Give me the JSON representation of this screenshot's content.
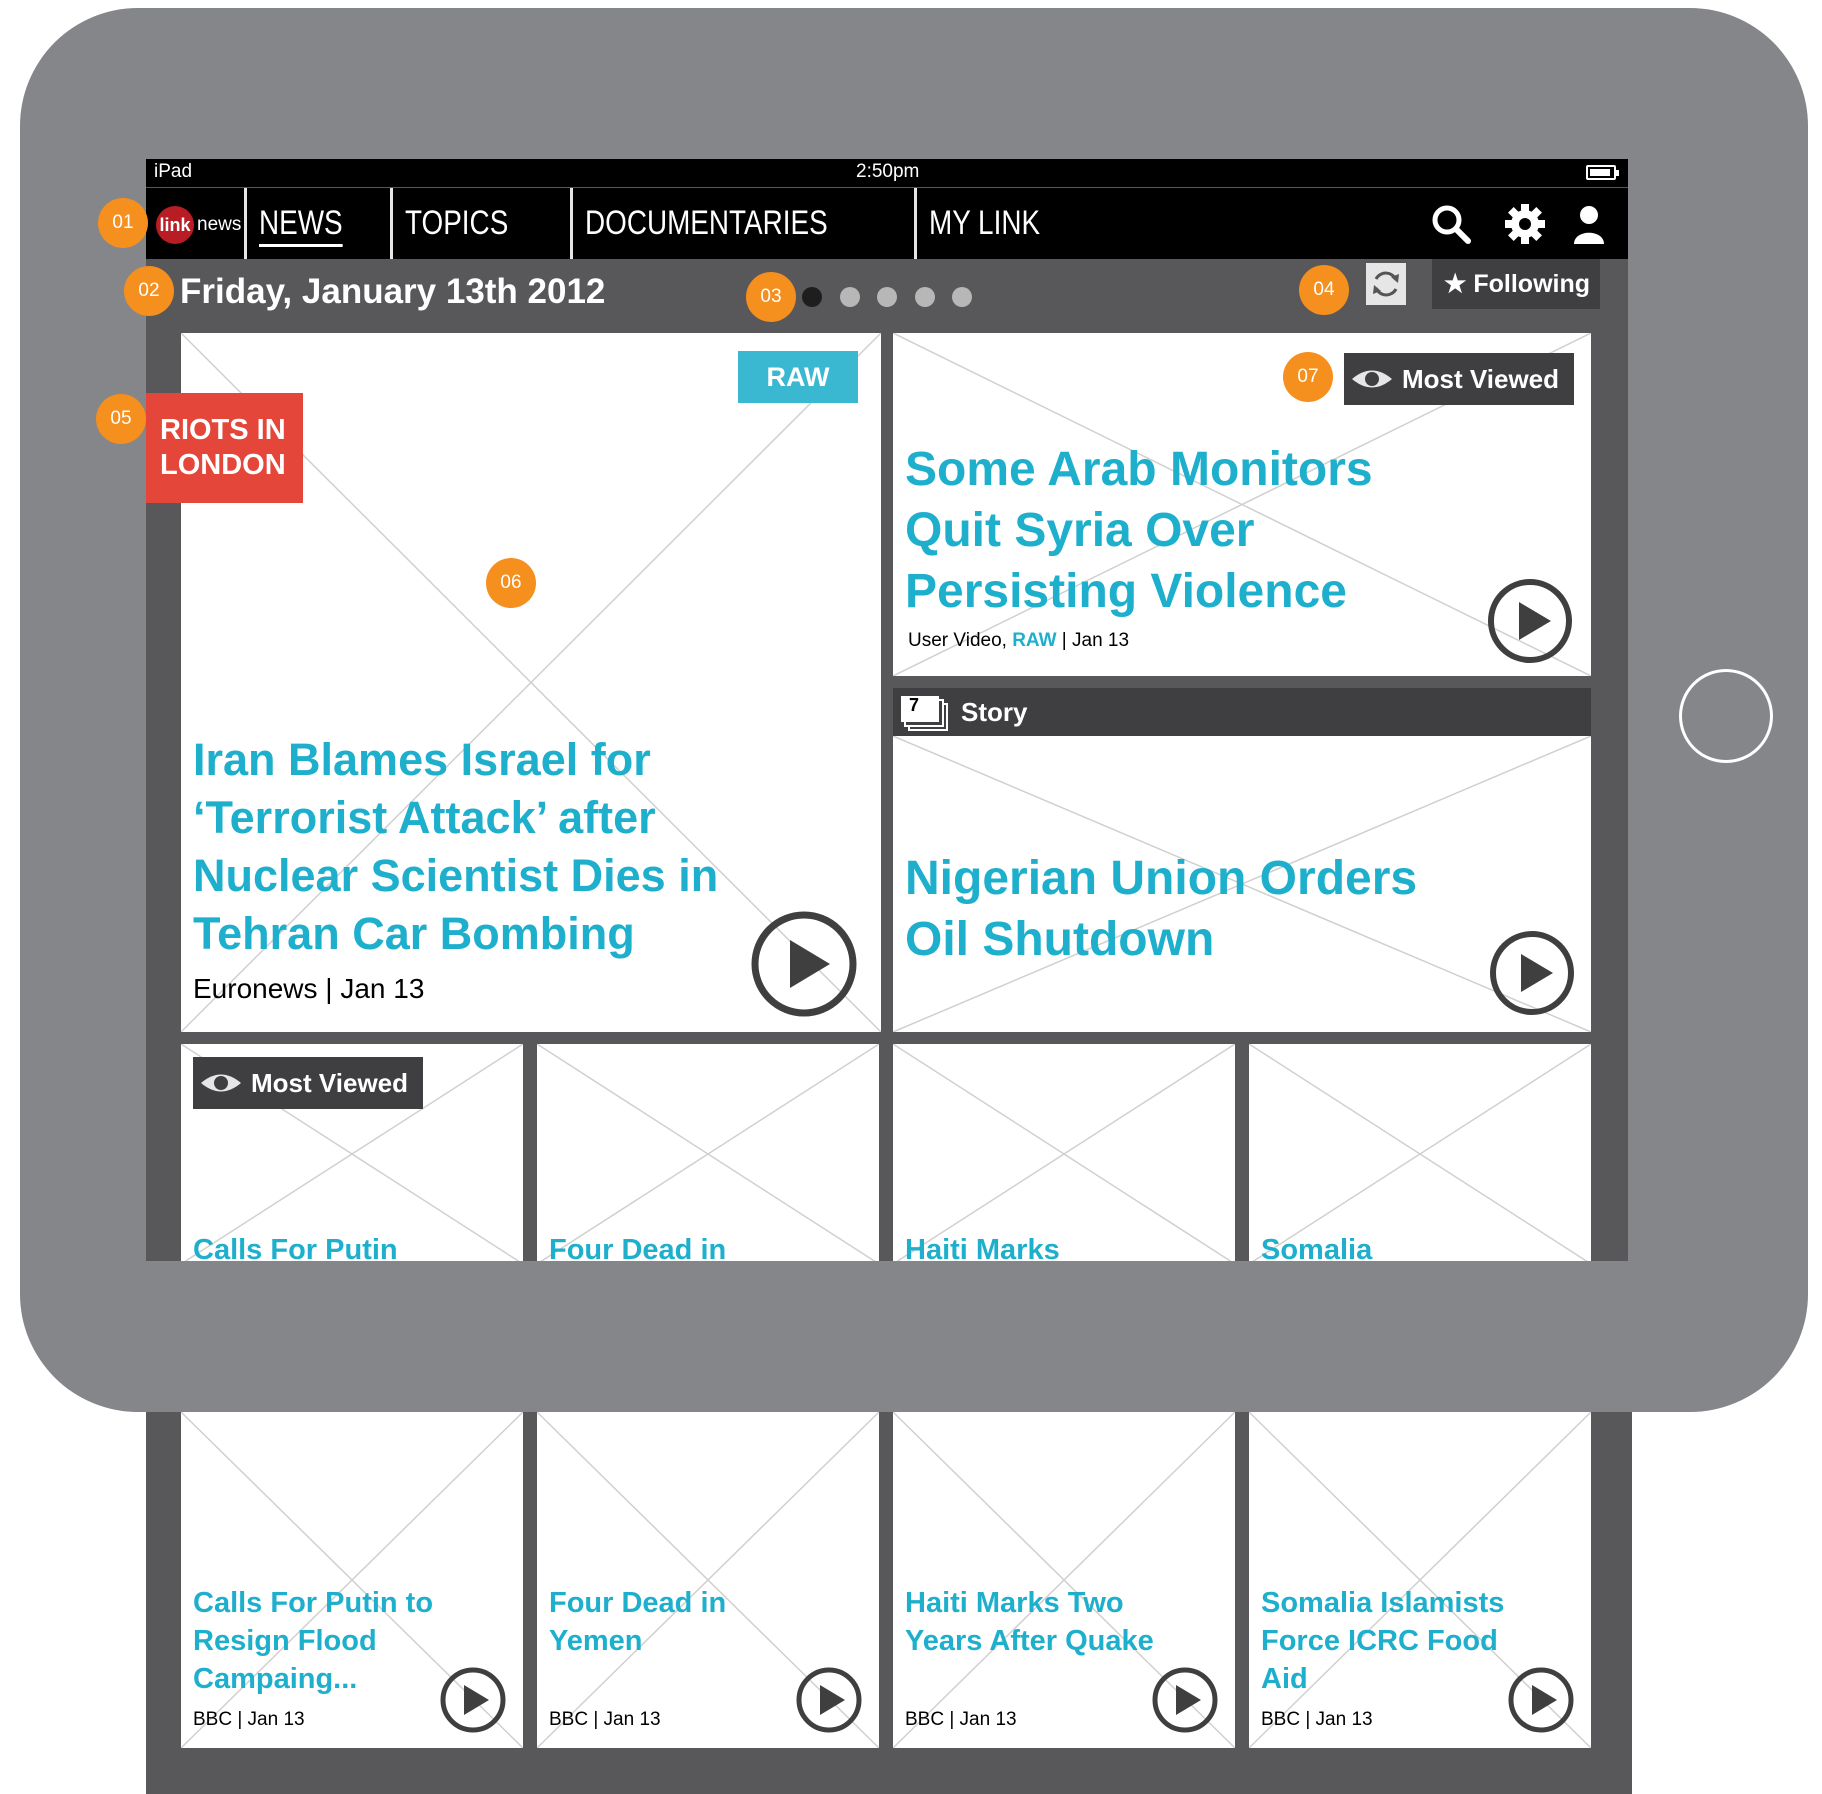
{
  "status_bar": {
    "device": "iPad",
    "time": "2:50pm"
  },
  "nav": {
    "logo_mark": "link",
    "logo_text": "news",
    "tabs": [
      "NEWS",
      "TOPICS",
      "DOCUMENTARIES",
      "MY LINK"
    ],
    "active_tab": "NEWS"
  },
  "date_label": "Friday, January 13th 2012",
  "pager": {
    "pages": 5,
    "current": 1
  },
  "following_label": "★ Following",
  "markers": [
    "01",
    "02",
    "03",
    "04",
    "05",
    "06",
    "07"
  ],
  "featured": {
    "topic_tag": [
      "RIOTS IN",
      "LONDON"
    ],
    "badge": "RAW",
    "headline": "Iran Blames Israel for ‘Terrorist Attack’ after Nuclear Scientist Dies in Tehran Car Bombing",
    "source": "Euronews | Jan 13"
  },
  "top_right": {
    "badge": "Most Viewed",
    "headline": "Some Arab Monitors Quit Syria Over Persisting Violence",
    "meta_prefix": "User Video, ",
    "meta_raw": "RAW",
    "meta_suffix": " | Jan 13"
  },
  "story": {
    "count": "7",
    "label": "Story",
    "headline": "Nigerian Union Orders Oil Shutdown"
  },
  "row_badge": "Most Viewed",
  "peek_titles": [
    "Calls For Putin",
    "Four Dead in",
    "Haiti Marks",
    "Somalia"
  ],
  "bottom_tiles": [
    {
      "headline": "Calls For Putin to Resign Flood Campaing...",
      "source": "BBC | Jan 13"
    },
    {
      "headline": "Four Dead in Yemen",
      "source": "BBC | Jan 13"
    },
    {
      "headline": "Haiti Marks Two Years After Quake",
      "source": "BBC | Jan 13"
    },
    {
      "headline": "Somalia Islamists Force ICRC Food Aid",
      "source": "BBC | Jan 13"
    }
  ],
  "colors": {
    "headline": "#1eafcd",
    "marker": "#f58f1d",
    "raw_badge": "#3ab8d2",
    "topic_tag": "#e4463a",
    "device_frame": "#858689",
    "screen_bg": "#58585b"
  },
  "icons": [
    "search-icon",
    "gear-icon",
    "user-icon",
    "refresh-icon",
    "eye-icon",
    "play-icon",
    "star-icon",
    "stack-icon"
  ]
}
